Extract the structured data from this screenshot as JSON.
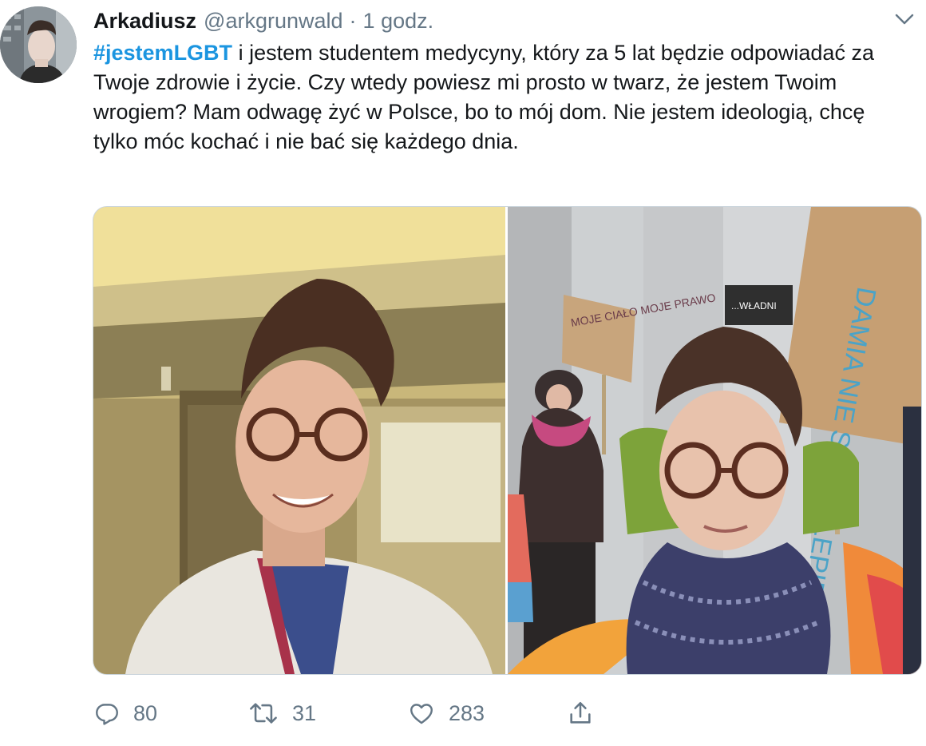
{
  "author": {
    "name": "Arkadiusz",
    "handle": "@arkgrunwald",
    "separator": "·",
    "time": "1 godz."
  },
  "tweet": {
    "hashtag": "#jestemLGBT",
    "text": " i jestem studentem medycyny, który za 5 lat będzie odpowiadać za Twoje zdrowie i życie. Czy wtedy powiesz mi prosto w twarz, że jestem Twoim wrogiem? Mam odwagę żyć w Polsce, bo to mój dom. Nie jestem ideologią, chcę tylko móc kochać i nie bać się każdego dnia."
  },
  "photos": {
    "left_sign_text": "",
    "right_signs": [
      "MOJE CIAŁO MOJE PRAWO",
      "...WŁADNI",
      "DAMIA NIE SZ NAJLEPIEJ"
    ]
  },
  "stats": {
    "replies": "80",
    "retweets": "31",
    "likes": "283"
  },
  "icons": {
    "reply": "reply-icon",
    "retweet": "retweet-icon",
    "like": "heart-icon",
    "share": "share-icon",
    "menu": "chevron-down-icon"
  },
  "colors": {
    "hashtag": "#1b95e0",
    "secondary_text": "#657786"
  }
}
